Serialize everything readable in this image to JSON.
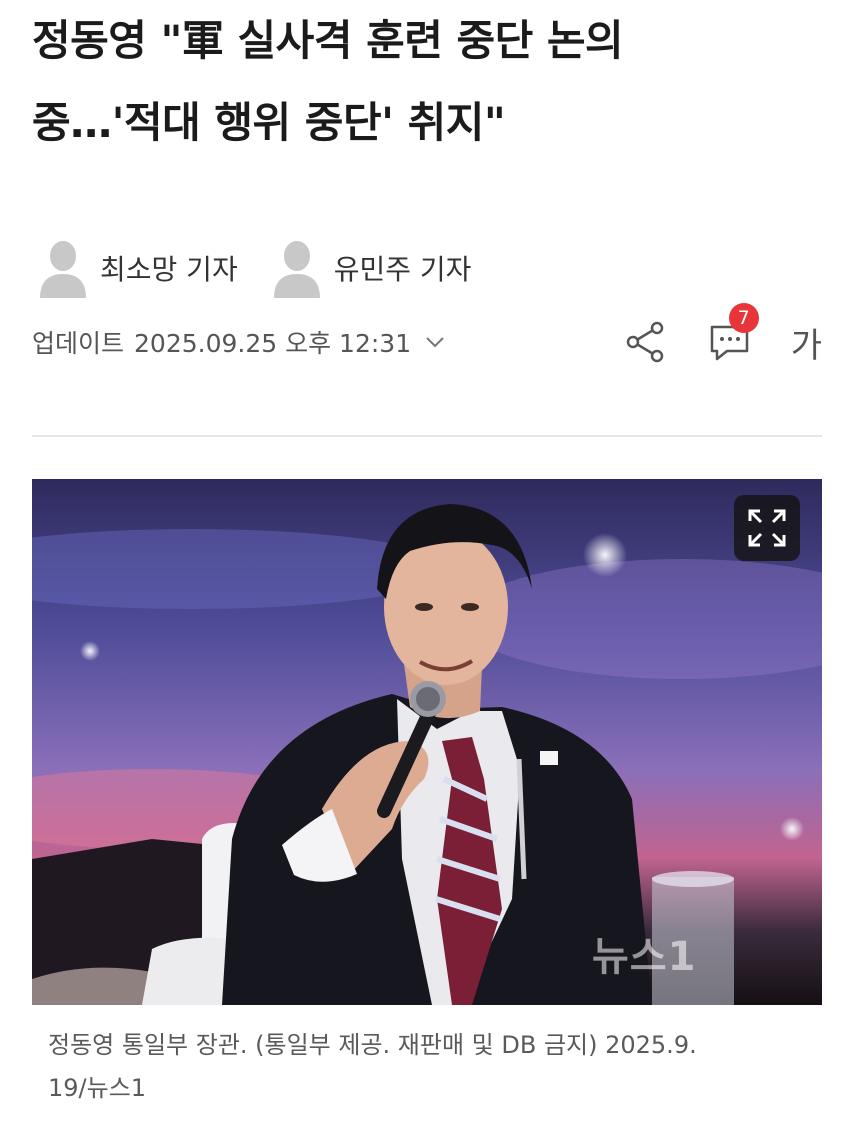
{
  "article": {
    "title_line1": "정동영 \"軍 실사격 훈련 중단 논의",
    "title_line2": "중…'적대 행위 중단' 취지\""
  },
  "reporters": [
    {
      "name": "최소망 기자",
      "icon": "person-silhouette-icon"
    },
    {
      "name": "유민주 기자",
      "icon": "person-silhouette-icon"
    }
  ],
  "meta": {
    "update_label": "업데이트",
    "update_time": "2025.09.25 오후 12:31",
    "comment_count": "7",
    "font_size_label": "가",
    "icons": {
      "share": "share-icon",
      "comment": "comment-icon",
      "expand": "expand-icon",
      "dropdown": "chevron-down-icon"
    }
  },
  "photo": {
    "watermark": "뉴스1",
    "caption_line1": "정동영 통일부 장관. (통일부 제공. 재판매 및 DB 금지) 2025.9.",
    "caption_line2": "19/뉴스1"
  },
  "colors": {
    "badge": "#e8353a",
    "text": "#1b1b1b",
    "muted": "#5a5a5a"
  }
}
